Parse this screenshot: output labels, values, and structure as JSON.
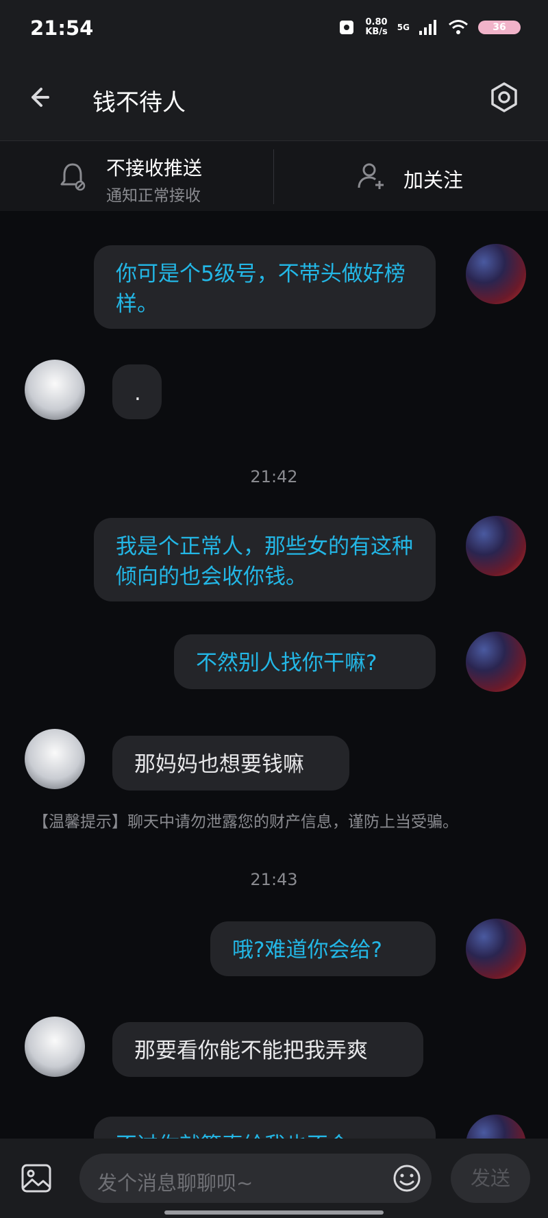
{
  "status_bar": {
    "time": "21:54",
    "net_speed": "0.80",
    "net_unit": "KB/s",
    "signal": "5G",
    "battery": "36"
  },
  "header": {
    "title": "钱不待人"
  },
  "notify": {
    "push_title": "不接收推送",
    "push_sub": "通知正常接收",
    "follow_label": "加关注"
  },
  "messages": {
    "m1": "你可是个5级号，不带头做好榜样。",
    "m2": ".",
    "t1": "21:42",
    "m3": "我是个正常人，那些女的有这种倾向的也会收你钱。",
    "m4": "不然别人找你干嘛?",
    "m5": "那妈妈也想要钱嘛",
    "notice": "【温馨提示】聊天中请勿泄露您的财产信息，谨防上当受骗。",
    "t2": "21:43",
    "m6": "哦?难道你会给?",
    "m7": "那要看你能不能把我弄爽",
    "m8": "不过你就算真给我也不会"
  },
  "input": {
    "placeholder": "发个消息聊聊呗~",
    "send_label": "发送"
  }
}
